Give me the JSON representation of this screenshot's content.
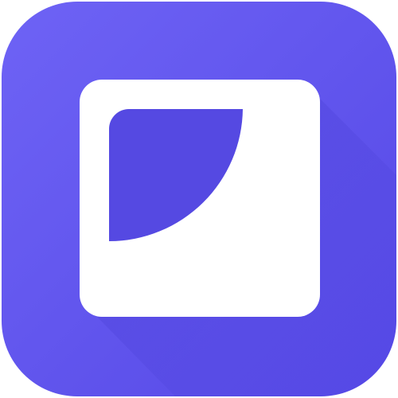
{
  "icon": {
    "name": "app-launcher-icon",
    "glyph": "rounded-square-with-quarter-circle-cutout",
    "colors": {
      "background_top_left": "#6e63f5",
      "background_bottom_right": "#5548e6",
      "long_shadow": "#4a3fd6",
      "tile": "#ffffff",
      "cutout": "#5549e2"
    }
  }
}
